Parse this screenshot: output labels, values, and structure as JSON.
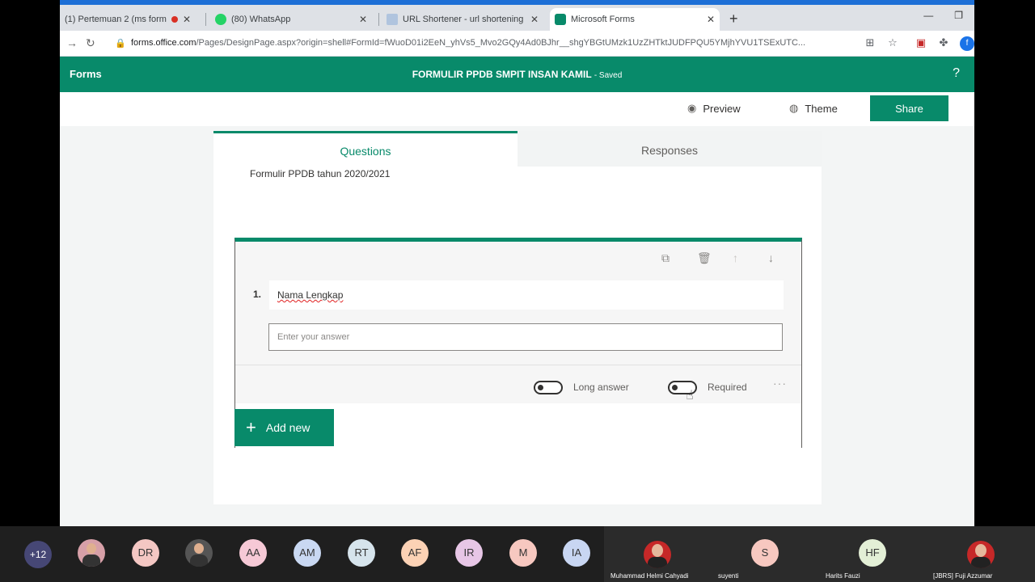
{
  "browser": {
    "tabs": [
      {
        "title": "(1) Pertemuan 2 (ms form &",
        "favicon_color": "#c4302b"
      },
      {
        "title": "(80) WhatsApp",
        "favicon_color": "#25d366"
      },
      {
        "title": "URL Shortener - url shortening s",
        "favicon_color": "#9aa0a6"
      },
      {
        "title": "Microsoft Forms",
        "favicon_color": "#088a6a"
      }
    ],
    "url_host": "forms.office.com",
    "url_path": "/Pages/DesignPage.aspx?origin=shell#FormId=fWuoD01i2EeN_yhVs5_Mvo2GQy4Ad0BJhr__shgYBGtUMzk1UzZHTktJUDFPQU5YMjhYVU1TSExUTC...",
    "profile_initial": "f"
  },
  "forms_header": {
    "brand": "Forms",
    "form_title": "FORMULIR PPDB SMPIT INSAN KAMIL",
    "saved": "- Saved",
    "help": "?"
  },
  "commands": {
    "preview": "Preview",
    "theme": "Theme",
    "share": "Share"
  },
  "form_tabs": {
    "questions": "Questions",
    "responses": "Responses"
  },
  "form_description": "Formulir PPDB tahun 2020/2021",
  "question": {
    "number": "1.",
    "title": "Nama Lengkap",
    "answer_placeholder": "Enter your answer",
    "long_answer_label": "Long answer",
    "required_label": "Required",
    "more": "···"
  },
  "add_new": "Add new",
  "meeting": {
    "more_count": "+12",
    "avatars": [
      {
        "initials": "",
        "color": "#d7a0a8"
      },
      {
        "initials": "DR",
        "color": "#f4c7c3"
      },
      {
        "initials": "",
        "color": "#555555"
      },
      {
        "initials": "AA",
        "color": "#f6c9d6"
      },
      {
        "initials": "AM",
        "color": "#c9d8f2"
      },
      {
        "initials": "RT",
        "color": "#d6e4ec"
      },
      {
        "initials": "AF",
        "color": "#fcd2b5"
      },
      {
        "initials": "IR",
        "color": "#e7c6e6"
      },
      {
        "initials": "M",
        "color": "#f7c8c0"
      },
      {
        "initials": "IA",
        "color": "#c8d6f2"
      }
    ],
    "tiles": [
      {
        "name": "Muhammad Helmi Cahyadi"
      },
      {
        "name": "suyenti",
        "initials": "S",
        "color": "#f7c8c0"
      },
      {
        "name": "Harits Fauzi",
        "initials": "HF",
        "color": "#e3efd6"
      },
      {
        "name": "[JBRS] Fuji Azzumar"
      }
    ]
  }
}
